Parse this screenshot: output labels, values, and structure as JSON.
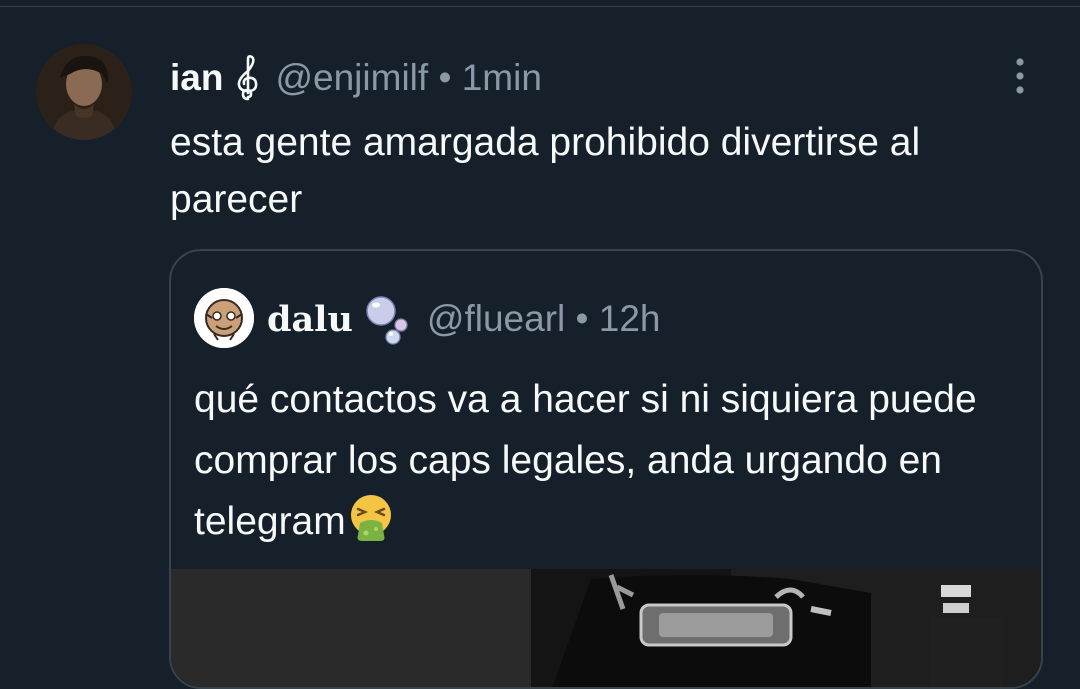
{
  "tweet": {
    "author": {
      "display_name": "ian",
      "name_emoji": "treble-clef-emoji",
      "handle": "@enjimilf",
      "separator": "•",
      "time": "1min"
    },
    "text": "esta gente amargada prohibido divertirse al parecer",
    "more_icon": "more-vertical-icon",
    "quoted": {
      "author": {
        "display_name": "dalu",
        "name_emoji": "bubbles-emoji",
        "handle": "@fluearl",
        "separator": "•",
        "time": "12h"
      },
      "text": "qué contactos va a hacer si ni siquiera puede comprar los caps legales, anda urgando en telegram",
      "text_emoji": "vomiting-face-emoji"
    }
  },
  "colors": {
    "background": "#15202b",
    "primary_text": "#f7f9f9",
    "secondary_text": "#8b98a5",
    "border": "#38444d"
  }
}
